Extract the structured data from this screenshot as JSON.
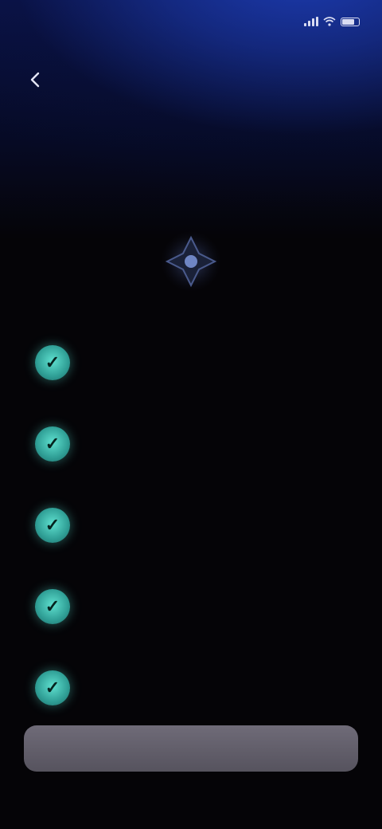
{
  "status_bar": {
    "time": "",
    "icons": [
      "signal-icon",
      "wifi-icon",
      "battery-icon"
    ]
  },
  "header": {
    "back_icon": "chevron-left-icon",
    "title": "",
    "subtitle": ""
  },
  "headline": {
    "bold": "",
    "rest": ""
  },
  "hero": {
    "icon": "diamond-star-icon",
    "accent": "#5fe0cf"
  },
  "features": [
    {
      "icon": "check-icon",
      "text": "",
      "value": ""
    },
    {
      "icon": "check-icon",
      "text": "",
      "value": ""
    },
    {
      "icon": "check-icon",
      "text": "",
      "value": ""
    },
    {
      "icon": "check-icon",
      "text": "",
      "value": ""
    },
    {
      "icon": "check-icon",
      "text": "",
      "value": ""
    }
  ],
  "cta": {
    "label": ""
  },
  "colors": {
    "accent": "#2f9e95",
    "background": "#050407",
    "header_glow": "#1c3bb0",
    "button": "#6f6b78"
  }
}
